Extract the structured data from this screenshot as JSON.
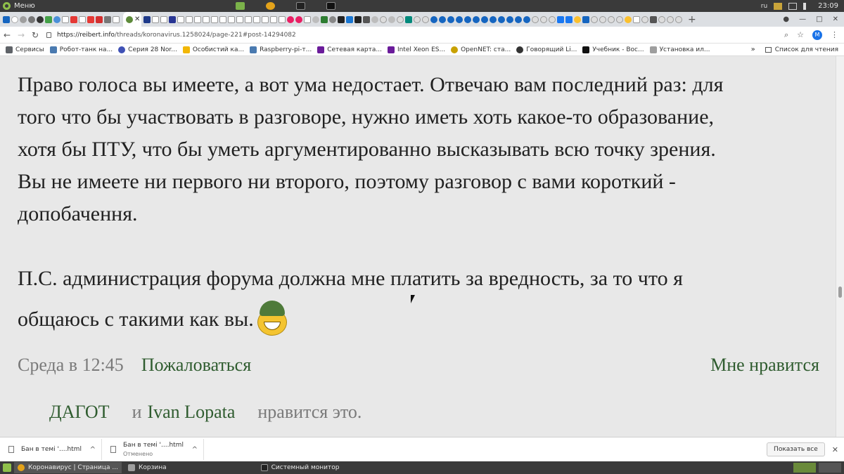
{
  "os_panel": {
    "menu_label": "Меню",
    "lang": "ru",
    "clock": "23:09"
  },
  "browser": {
    "active_tab_close": "✕",
    "new_tab": "+",
    "url_host": "https://reibert.info",
    "url_path": "/threads/koronavirus.1258024/page-221#post-14294082",
    "profile_initial": "M"
  },
  "bookmarks": {
    "items": [
      {
        "label": "Сервисы",
        "color": "#5f6368"
      },
      {
        "label": "Робот-танк на...",
        "color": "#4a7ab0"
      },
      {
        "label": "Серия 28 Nor...",
        "color": "#3f51b5"
      },
      {
        "label": "Особистий ка...",
        "color": "#f2b705"
      },
      {
        "label": "Raspberry-pi-т...",
        "color": "#4a7ab0"
      },
      {
        "label": "Сетевая карта...",
        "color": "#6a1b9a"
      },
      {
        "label": "Intel Xeon ES...",
        "color": "#6a1b9a"
      },
      {
        "label": "OpenNET: ста...",
        "color": "#c8a100"
      },
      {
        "label": "Говорящий Li...",
        "color": "#333333"
      },
      {
        "label": "Учебник - Вос...",
        "color": "#111111"
      },
      {
        "label": "Установка ил...",
        "color": "#9e9e9e"
      }
    ],
    "more": "»",
    "reading_list": "Список для чтения"
  },
  "post": {
    "paragraph1_lines": [
      "Право голоса вы имеете, а вот ума недостает. Отвечаю вам последний раз: для",
      "того что бы участвовать в разговоре, нужно иметь хоть какое-то образование,",
      "хотя бы ПТУ, что бы уметь аргументированно высказывать всю точку зрения.",
      "Вы не имеете ни первого ни второго, поэтому разговор с вами короткий -",
      "допобачення."
    ],
    "ps_line1": "П.С. администрация форума должна мне платить за вредность, за то что я",
    "ps_line2": "общаюсь с такими как вы.",
    "date": "Среда в 12:45",
    "report_label": "Пожаловаться",
    "like_label": "Мне нравится",
    "likers": [
      "ДАГОТ",
      "Ivan Lopata"
    ],
    "likes_and": "и",
    "likes_suffix": "нравится это."
  },
  "downloads": {
    "items": [
      {
        "name": "Бан в темі '....html",
        "status": ""
      },
      {
        "name": "Бан в темі '....html",
        "status": "Отменено"
      }
    ],
    "chevron": "^",
    "show_all": "Показать все",
    "close": "✕"
  },
  "taskbar": {
    "windows": [
      {
        "label": "Коронавирус | Страница ...",
        "active": true
      },
      {
        "label": "Корзина",
        "active": false
      },
      {
        "label": "Системный монитор",
        "active": false
      }
    ]
  },
  "colors": {
    "link_green": "#2f5c2f",
    "muted_gray": "#7a7a7a",
    "body_text": "#212121",
    "content_bg": "#e8e8e8"
  }
}
